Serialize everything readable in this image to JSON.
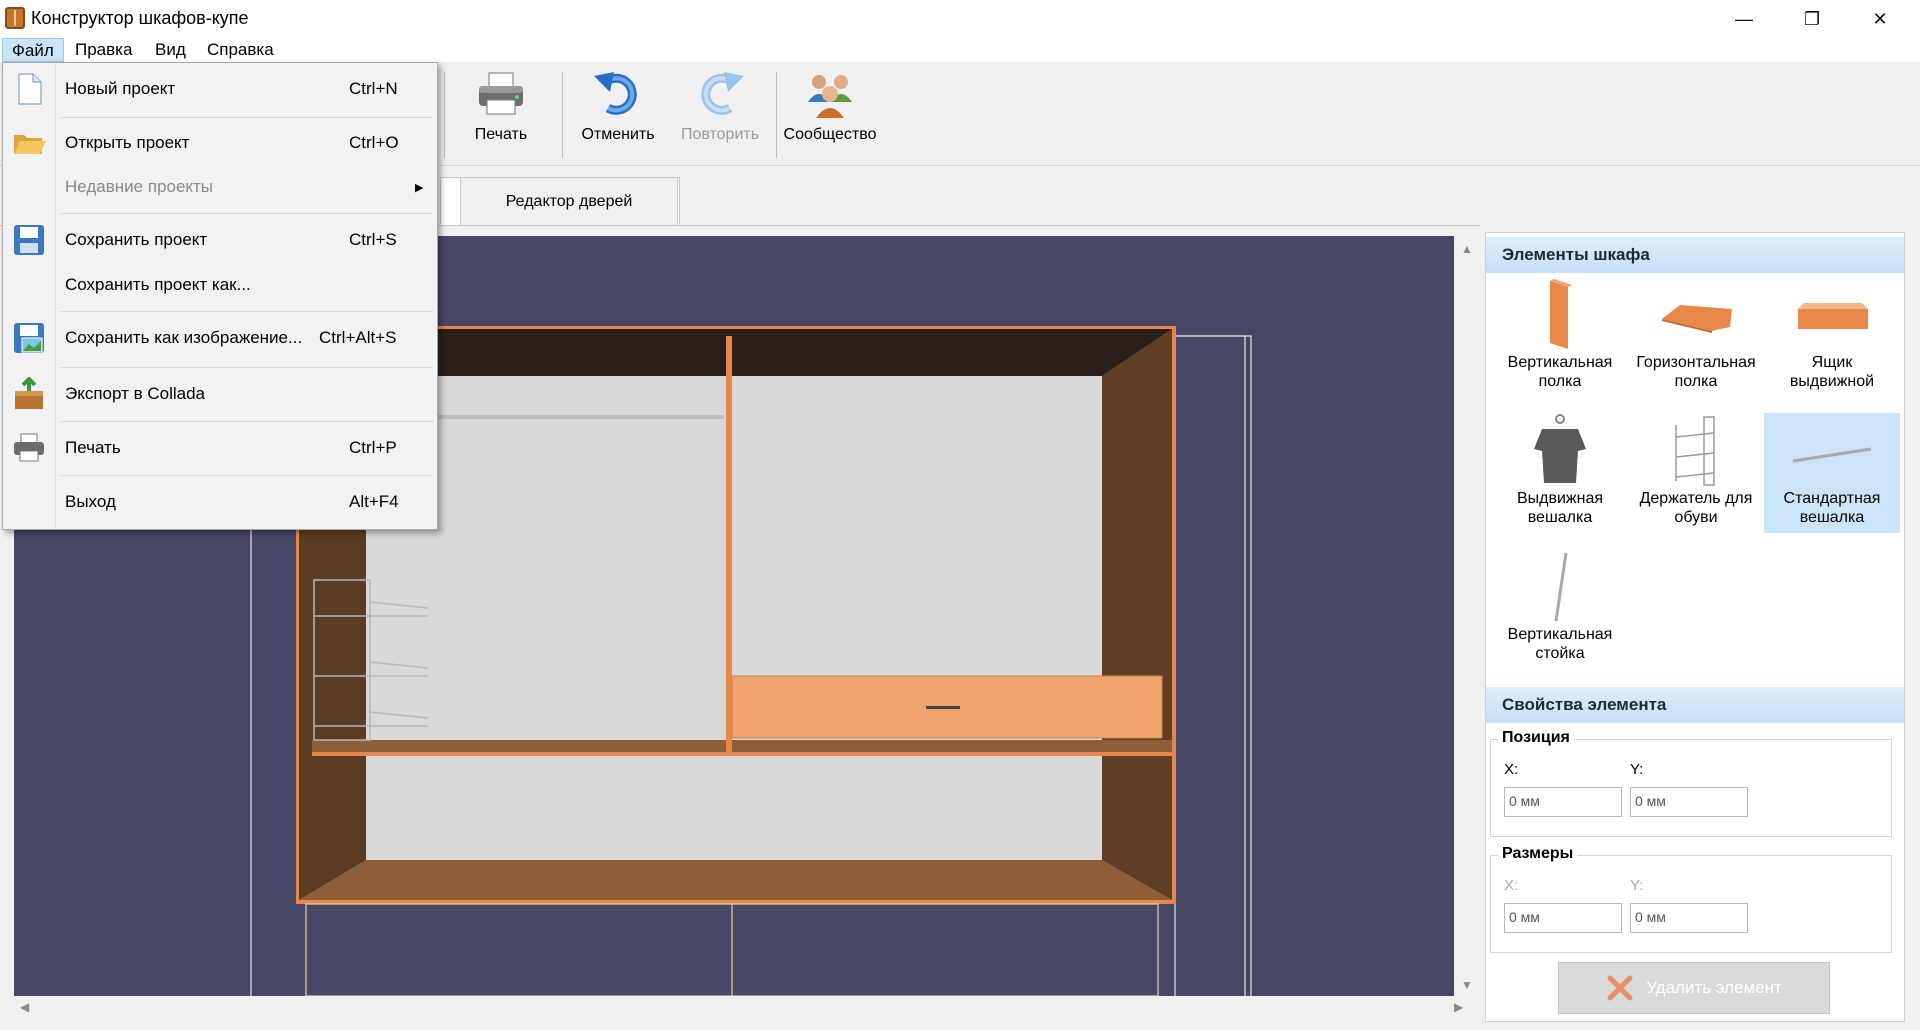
{
  "window": {
    "title": "Конструктор шкафов-купе",
    "minimize": "—",
    "maximize": "❐",
    "close": "✕"
  },
  "menubar": {
    "file": "Файл",
    "edit": "Правка",
    "view": "Вид",
    "help": "Справка"
  },
  "toolbar": {
    "print": "Печать",
    "undo": "Отменить",
    "redo": "Повторить",
    "community": "Сообщество"
  },
  "tabs": {
    "door_editor": "Редактор дверей"
  },
  "file_menu": {
    "new_project": {
      "label": "Новый проект",
      "shortcut": "Ctrl+N"
    },
    "open_project": {
      "label": "Открыть проект",
      "shortcut": "Ctrl+O"
    },
    "recent_projects": {
      "label": "Недавние проекты"
    },
    "save_project": {
      "label": "Сохранить проект",
      "shortcut": "Ctrl+S"
    },
    "save_project_as": {
      "label": "Сохранить проект как..."
    },
    "save_as_image": {
      "label": "Сохранить как изображение...",
      "shortcut": "Ctrl+Alt+S"
    },
    "export_collada": {
      "label": "Экспорт в Collada"
    },
    "print": {
      "label": "Печать",
      "shortcut": "Ctrl+P"
    },
    "exit": {
      "label": "Выход",
      "shortcut": "Alt+F4"
    }
  },
  "elements_panel": {
    "header": "Элементы шкафа",
    "items": [
      {
        "l1": "Вертикальная",
        "l2": "полка"
      },
      {
        "l1": "Горизонтальная",
        "l2": "полка"
      },
      {
        "l1": "Ящик",
        "l2": "выдвижной"
      },
      {
        "l1": "Выдвижная",
        "l2": "вешалка"
      },
      {
        "l1": "Держатель для",
        "l2": "обуви"
      },
      {
        "l1": "Стандартная",
        "l2": "вешалка"
      },
      {
        "l1": "Вертикальная",
        "l2": "стойка"
      }
    ]
  },
  "properties_panel": {
    "header": "Свойства элемента",
    "position": {
      "title": "Позиция",
      "x_label": "X:",
      "y_label": "Y:",
      "x_value": "0 мм",
      "y_value": "0 мм"
    },
    "sizes": {
      "title": "Размеры",
      "x_label": "X:",
      "y_label": "Y:",
      "x_value": "0 мм",
      "y_value": "0 мм"
    },
    "delete_button": "Удалить элемент"
  },
  "colors": {
    "viewport_bg": "#474664",
    "panel_orange": "#e8874a",
    "selection": "#cce4f7"
  }
}
